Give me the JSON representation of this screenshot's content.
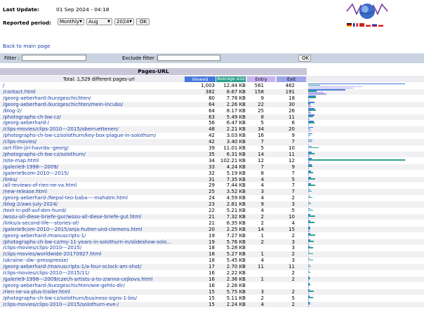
{
  "header": {
    "last_update_label": "Last Update:",
    "last_update_value": "01 Sep 2024 - 04:18",
    "reported_period_label": "Reported period:",
    "period_type": "Monthly",
    "month": "Aug",
    "year": "2024",
    "ok_label": "OK"
  },
  "nav": {
    "back_link": "Back to main page"
  },
  "filters": {
    "filter_label": "Filter :",
    "exclude_label": "Exclude filter :",
    "ok_label": "OK"
  },
  "table": {
    "title": "Pages-URL",
    "total_label": "Total: 1,529 different pages-url",
    "columns": [
      "Viewed",
      "Average size",
      "Entry",
      "Exit"
    ],
    "colors": {
      "viewed": "#4477dd",
      "avg": "#2ea28e",
      "entry": "#c7b3f0",
      "exit": "#9fa6e8"
    },
    "rows": [
      {
        "url": "/",
        "viewed": "1,003",
        "avg": "12.44 KB",
        "entry": "561",
        "exit": "462"
      },
      {
        "url": "/contact.html",
        "viewed": "382",
        "avg": "8.67 KB",
        "entry": "158",
        "exit": "191"
      },
      {
        "url": "/georg-aeberhard-/kurzgeschichten/",
        "viewed": "80",
        "avg": "7.78 KB",
        "entry": "9",
        "exit": "18"
      },
      {
        "url": "/georg-aeberhard-/kurzgeschichten/mein-incubo/",
        "viewed": "64",
        "avg": "2.26 KB",
        "entry": "22",
        "exit": "30"
      },
      {
        "url": "/blog-2/",
        "viewed": "64",
        "avg": "8.17 KB",
        "entry": "25",
        "exit": "26"
      },
      {
        "url": "/photographs-ch-bw-cz/",
        "viewed": "63",
        "avg": "5.49 KB",
        "entry": "8",
        "exit": "11"
      },
      {
        "url": "/georg-aeberhard-/",
        "viewed": "56",
        "avg": "6.47 KB",
        "entry": "5",
        "exit": "6"
      },
      {
        "url": "/clips-movies/clips-2010---2015/oberruettenen/",
        "viewed": "48",
        "avg": "2.21 KB",
        "entry": "34",
        "exit": "20"
      },
      {
        "url": "/photographs-ch-bw-cz/solothurn/key-box-plague-in-solothurn/",
        "viewed": "42",
        "avg": "3.03 KB",
        "entry": "16",
        "exit": "9"
      },
      {
        "url": "/clips-movies/",
        "viewed": "42",
        "avg": "3.40 KB",
        "entry": "7",
        "exit": "7"
      },
      {
        "url": "/art-film-jiri-havrda--georg/",
        "viewed": "39",
        "avg": "11.01 KB",
        "entry": "5",
        "exit": "10"
      },
      {
        "url": "/photographs-ch-bw-cz/solothurn/",
        "viewed": "35",
        "avg": "6.31 KB",
        "entry": "14",
        "exit": "11"
      },
      {
        "url": "/site-map.html",
        "viewed": "34",
        "avg": "102.21 KB",
        "entry": "12",
        "exit": "12"
      },
      {
        "url": "/galerie9-1998---2009/",
        "viewed": "33",
        "avg": "4.24 KB",
        "entry": "7",
        "exit": "9"
      },
      {
        "url": "/galerie9com-2010---2015/",
        "viewed": "32",
        "avg": "5.19 KB",
        "entry": "8",
        "exit": "7"
      },
      {
        "url": "/links/",
        "viewed": "31",
        "avg": "7.35 KB",
        "entry": "4",
        "exit": "5"
      },
      {
        "url": "/all-reviews-of-rien-ne-va.html",
        "viewed": "29",
        "avg": "7.44 KB",
        "entry": "4",
        "exit": "7"
      },
      {
        "url": "/new-release.html",
        "viewed": "25",
        "avg": "3.52 KB",
        "entry": "3",
        "exit": "7"
      },
      {
        "url": "/georg-aeberhard-/Nepal-teo-baba----mahatm.html",
        "viewed": "24",
        "avg": "4.59 KB",
        "entry": "4",
        "exit": "2"
      },
      {
        "url": "/blog-2/aws-july-2024/",
        "viewed": "23",
        "avg": "2.81 KB",
        "entry": "9",
        "exit": "3"
      },
      {
        "url": "/text-in-pdf-auf-den-hund/",
        "viewed": "22",
        "avg": "5.21 KB",
        "entry": "4",
        "exit": "5"
      },
      {
        "url": "/wozu-all-diese-briefe-gur/wozu-all-diese-briefe-gut.html",
        "viewed": "21",
        "avg": "7.32 KB",
        "entry": "2",
        "exit": "10"
      },
      {
        "url": "/links/a-second-life---stories-of/",
        "viewed": "21",
        "avg": "6.35 KB",
        "entry": "2",
        "exit": "4"
      },
      {
        "url": "/galerie9com-2010---2015/anja-hutter-und-clemens.html",
        "viewed": "20",
        "avg": "2.25 KB",
        "entry": "14",
        "exit": "15"
      },
      {
        "url": "/georg-aeberhard-/manuscripts-1/",
        "viewed": "19",
        "avg": "7.27 KB",
        "entry": "1",
        "exit": "2"
      },
      {
        "url": "/photographs-ch-bw-cz/my-11-years-in-solothurn-in/slideshow-solo...",
        "viewed": "19",
        "avg": "5.76 KB",
        "entry": "2",
        "exit": "3"
      },
      {
        "url": "/clips-movies/clips-2010---2015/",
        "viewed": "18",
        "avg": "5.28 KB",
        "entry": "",
        "exit": "3"
      },
      {
        "url": "/clips-movies/worldwide-20170927.html",
        "viewed": "18",
        "avg": "5.27 KB",
        "entry": "1",
        "exit": "2"
      },
      {
        "url": "/ukraine--dw--presspresse/",
        "viewed": "18",
        "avg": "5.45 KB",
        "entry": "4",
        "exit": "3"
      },
      {
        "url": "/georg-aeberhard-/manuscripts-1/a-four-oclock-am-shot/",
        "viewed": "17",
        "avg": "2.70 KB",
        "entry": "11",
        "exit": "11"
      },
      {
        "url": "/clips-movies/clips-2010---2015/11/",
        "viewed": "16",
        "avg": "2.22 KB",
        "entry": "",
        "exit": "2"
      },
      {
        "url": "/galerie9-1998---2009/czech-artists-a-to-z/anna-cejkova.html",
        "viewed": "16",
        "avg": "2.36 KB",
        "entry": "1",
        "exit": "2"
      },
      {
        "url": "/georg-aeberhard-/kurzgeschichten/wie-gehts-dir/",
        "viewed": "16",
        "avg": "2.26 KB",
        "entry": "",
        "exit": ""
      },
      {
        "url": "/rien-ne-va-plus-trailer.html",
        "viewed": "15",
        "avg": "5.75 KB",
        "entry": "3",
        "exit": "2"
      },
      {
        "url": "/photographs-ch-bw-cz/solothurn/business-signs-1-bis/",
        "viewed": "15",
        "avg": "5.11 KB",
        "entry": "2",
        "exit": "5"
      },
      {
        "url": "/clips-movies/clips-2010---2015/solothurn-eve-/",
        "viewed": "15",
        "avg": "2.24 KB",
        "entry": "4",
        "exit": "2"
      }
    ]
  }
}
